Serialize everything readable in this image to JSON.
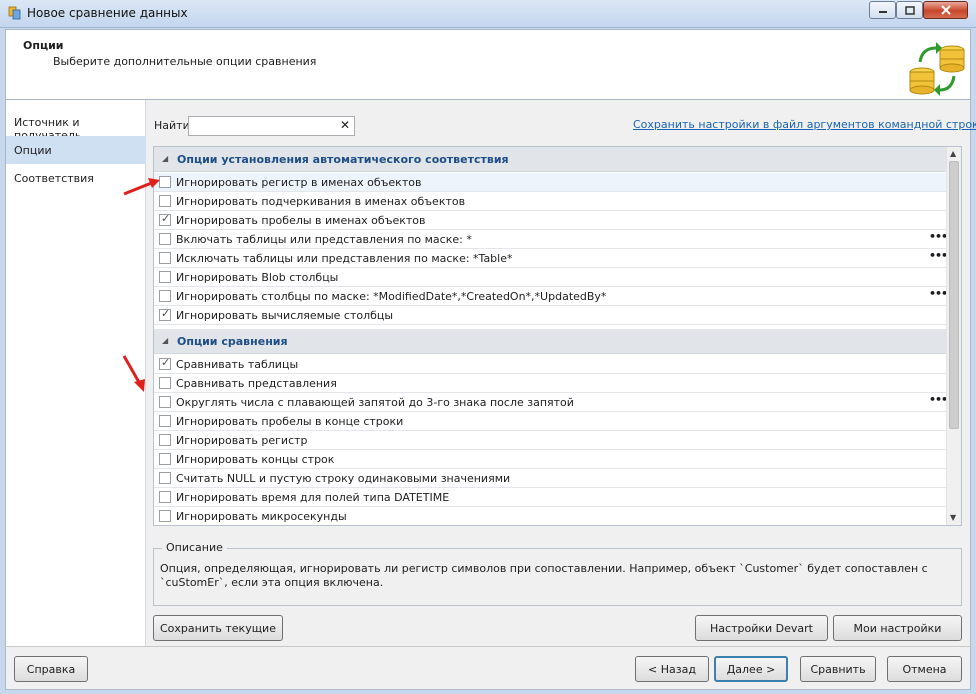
{
  "window": {
    "title": "Новое сравнение данных"
  },
  "header": {
    "title": "Опции",
    "subtitle": "Выберите дополнительные опции сравнения"
  },
  "nav": {
    "items": [
      {
        "label": "Источник и получатель",
        "active": false
      },
      {
        "label": "Опции",
        "active": true
      },
      {
        "label": "Соответствия",
        "active": false
      }
    ]
  },
  "search": {
    "label": "Найти",
    "value": "",
    "placeholder": ""
  },
  "save_link": "Сохранить настройки в файл аргументов командной строки...",
  "groups": [
    {
      "title": "Опции установления автоматического соответствия",
      "rows": [
        {
          "label": "Игнорировать регистр в именах объектов",
          "checked": false,
          "ellipsis": false,
          "selected": true
        },
        {
          "label": "Игнорировать подчеркивания в именах объектов",
          "checked": false,
          "ellipsis": false
        },
        {
          "label": "Игнорировать пробелы в именах объектов",
          "checked": true,
          "ellipsis": false
        },
        {
          "label": "Включать таблицы или представления по маске: *",
          "checked": false,
          "ellipsis": true
        },
        {
          "label": "Исключать таблицы или представления по маске: *Table*",
          "checked": false,
          "ellipsis": true
        },
        {
          "label": "Игнорировать Blob столбцы",
          "checked": false,
          "ellipsis": false
        },
        {
          "label": "Игнорировать столбцы по маске: *ModifiedDate*,*CreatedOn*,*UpdatedBy*",
          "checked": false,
          "ellipsis": true
        },
        {
          "label": "Игнорировать вычисляемые столбцы",
          "checked": true,
          "ellipsis": false
        }
      ]
    },
    {
      "title": "Опции сравнения",
      "rows": [
        {
          "label": "Сравнивать таблицы",
          "checked": true,
          "ellipsis": false
        },
        {
          "label": "Сравнивать представления",
          "checked": false,
          "ellipsis": false
        },
        {
          "label": "Округлять числа с плавающей запятой до 3-го знака после запятой",
          "checked": false,
          "ellipsis": true
        },
        {
          "label": "Игнорировать пробелы в конце строки",
          "checked": false,
          "ellipsis": false
        },
        {
          "label": "Игнорировать регистр",
          "checked": false,
          "ellipsis": false
        },
        {
          "label": "Игнорировать концы строк",
          "checked": false,
          "ellipsis": false
        },
        {
          "label": "Считать NULL и пустую строку одинаковыми значениями",
          "checked": false,
          "ellipsis": false
        },
        {
          "label": "Игнорировать время для полей типа DATETIME",
          "checked": false,
          "ellipsis": false
        },
        {
          "label": "Игнорировать микросекунды",
          "checked": false,
          "ellipsis": false
        }
      ]
    }
  ],
  "ellipsis_glyph": "•••",
  "description": {
    "legend": "Описание",
    "text": "Опция, определяющая, игнорировать ли регистр символов при сопоставлении. Например, объект `Customer` будет сопоставлен с `cuStomEr`, если эта опция включена."
  },
  "buttons": {
    "save_current": "Сохранить текущие",
    "devart_settings": "Настройки Devart",
    "my_settings": "Мои настройки",
    "help": "Справка",
    "back": "< Назад",
    "next": "Далее >",
    "compare": "Сравнить",
    "cancel": "Отмена"
  },
  "colors": {
    "accent": "#1a64b5",
    "group_title": "#1d4e86",
    "annotation_arrow": "#e0201a"
  },
  "icons": {
    "app": "data-compare-icon",
    "header": "database-sync-icon"
  }
}
